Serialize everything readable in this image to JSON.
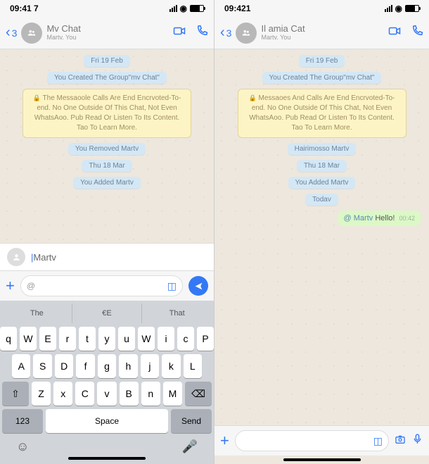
{
  "left": {
    "status": {
      "time": "09:41 7"
    },
    "header": {
      "back_count": "3",
      "title": "Mv Chat",
      "subtitle": "Martv. You"
    },
    "messages": {
      "date1": "Fri 19 Feb",
      "created": "You Created The Group\"mv Chat\"",
      "encryption": "The Messaoole Calls Are End Encrvoted-To-end. No One Outside Of This Chat, Not Even WhatsAoo. Pub Read Or Listen To Its Content. Tao To Learn More.",
      "removed": "You Removed Martv",
      "date2": "Thu 18 Mar",
      "added": "You Added Martv"
    },
    "mention_suggest": "Martv",
    "input_text": "@",
    "keyboard": {
      "suggestions": [
        "The",
        "€E",
        "That"
      ],
      "row1": [
        "q",
        "W",
        "E",
        "r",
        "t",
        "y",
        "u",
        "W",
        "i",
        "c",
        "P"
      ],
      "row2": [
        "A",
        "S",
        "D",
        "f",
        "g",
        "h",
        "j",
        "k",
        "L"
      ],
      "row3": [
        "Z",
        "x",
        "C",
        "v",
        "B",
        "n",
        "M"
      ],
      "k123": "123",
      "space": "Space",
      "send": "Send"
    }
  },
  "right": {
    "status": {
      "time": "09:421"
    },
    "header": {
      "back_count": "3",
      "title": "Il amia Cat",
      "subtitle": "Martv. You"
    },
    "messages": {
      "date1": "Fri 19 Feb",
      "created": "You Created The Group\"mv Chat\"",
      "encryption": "Messaoes And Calls Are End Encrvoted-To-end. No One Outside Of This Chat, Not Even WhatsAoo. Pub Read Or Listen To Its Content. Tao To Learn More.",
      "removed": "Hairimosso Martv",
      "date2": "Thu 18 Mar",
      "added": "You Added Martv",
      "today": "Todav",
      "sent_mention": "@ Martv",
      "sent_text": " Hello!",
      "sent_time": "00:42"
    }
  }
}
